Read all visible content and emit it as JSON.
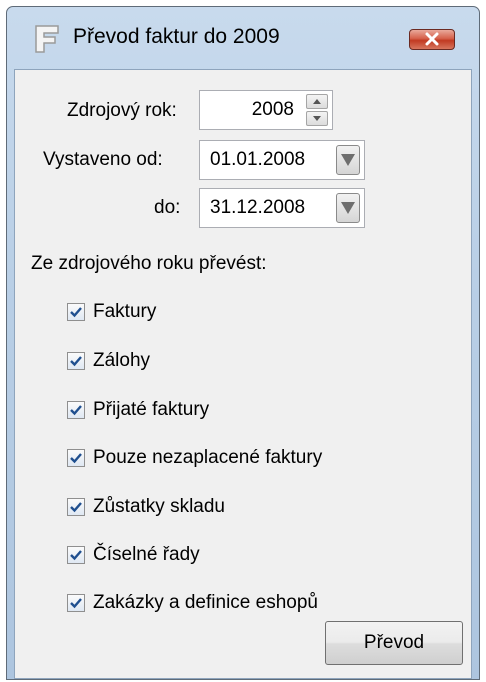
{
  "window": {
    "title": "Převod faktur do 2009"
  },
  "form": {
    "source_year_label": "Zdrojový rok:",
    "source_year_value": "2008",
    "issued_from_label": "Vystaveno od:",
    "issued_from_value": "01.01.2008",
    "issued_to_label": "do:",
    "issued_to_value": "31.12.2008",
    "section_label": "Ze zdrojového roku převést:"
  },
  "checkboxes": [
    {
      "label": "Faktury",
      "checked": true
    },
    {
      "label": "Zálohy",
      "checked": true
    },
    {
      "label": "Přijaté faktury",
      "checked": true
    },
    {
      "label": "Pouze nezaplacené faktury",
      "checked": true
    },
    {
      "label": "Zůstatky skladu",
      "checked": true
    },
    {
      "label": "Číselné řady",
      "checked": true
    },
    {
      "label": "Zakázky a definice eshopů",
      "checked": true
    }
  ],
  "actions": {
    "convert_label": "Převod"
  }
}
